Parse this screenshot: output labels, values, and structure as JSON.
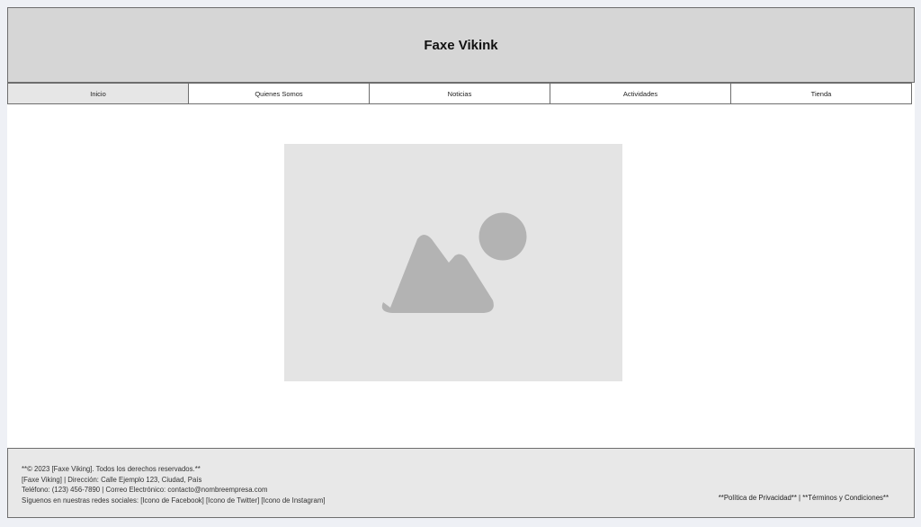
{
  "header": {
    "title": "Faxe Vikink"
  },
  "nav": {
    "items": [
      {
        "label": "Inicio",
        "active": true
      },
      {
        "label": "Quienes Somos",
        "active": false
      },
      {
        "label": "Noticias",
        "active": false
      },
      {
        "label": "Actividades",
        "active": false
      },
      {
        "label": "Tienda",
        "active": false
      }
    ]
  },
  "main": {
    "hero_image": {
      "icon": "image-placeholder-icon"
    }
  },
  "footer": {
    "copyright": "**© 2023 [Faxe Viking]. Todos los derechos reservados.**",
    "address": "[Faxe Viking] | Dirección: Calle Ejemplo 123, Ciudad, País",
    "contact": "Teléfono: (123) 456-7890 | Correo Electrónico: contacto@nombreempresa.com",
    "social": "Síguenos en nuestras redes sociales: [Icono de Facebook] [Icono de Twitter] [Icono de Instagram]",
    "legal": "**Política de Privacidad** | **Términos y Condiciones**"
  },
  "colors": {
    "header_bg": "#d6d6d6",
    "border": "#6e6e6e",
    "placeholder_bg": "#e4e4e4",
    "placeholder_shape": "#b3b3b3",
    "footer_bg": "#e8e8e8"
  }
}
